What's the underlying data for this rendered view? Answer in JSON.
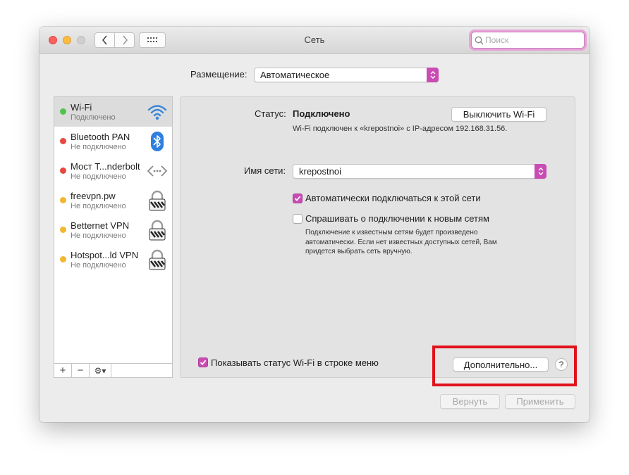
{
  "window": {
    "title": "Сеть"
  },
  "search": {
    "placeholder": "Поиск"
  },
  "location": {
    "label": "Размещение:",
    "value": "Автоматическое"
  },
  "services": [
    {
      "name": "Wi-Fi",
      "status": "Подключено",
      "status_color": "#4fc34a",
      "icon": "wifi-icon",
      "selected": true
    },
    {
      "name": "Bluetooth PAN",
      "status": "Не подключено",
      "status_color": "#e9473f",
      "icon": "bluetooth-icon"
    },
    {
      "name": "Мост T...nderbolt",
      "status": "Не подключено",
      "status_color": "#e9473f",
      "icon": "thunderbolt-bridge-icon"
    },
    {
      "name": "freevpn.pw",
      "status": "Не подключено",
      "status_color": "#f2b72f",
      "icon": "vpn-lock-icon"
    },
    {
      "name": "Betternet VPN",
      "status": "Не подключено",
      "status_color": "#f2b72f",
      "icon": "vpn-lock-icon"
    },
    {
      "name": "Hotspot...ld VPN",
      "status": "Не подключено",
      "status_color": "#f2b72f",
      "icon": "vpn-lock-icon"
    }
  ],
  "sidebar_tools": {
    "add": "+",
    "remove": "−",
    "gear": "⚙▾"
  },
  "panel": {
    "status_label": "Статус:",
    "status_value": "Подключено",
    "turn_off_button": "Выключить Wi-Fi",
    "status_detail": "Wi-Fi подключен к «krepostnoi» с IP-адресом 192.168.31.56.",
    "network_label": "Имя сети:",
    "network_value": "krepostnoi",
    "auto_join_label": "Автоматически подключаться к этой сети",
    "auto_join_checked": true,
    "ask_join_label": "Спрашивать о подключении к новым сетям",
    "ask_join_checked": false,
    "ask_join_note_1": "Подключение к известным сетям будет произведено",
    "ask_join_note_2": "автоматически. Если нет известных доступных сетей, Вам",
    "ask_join_note_3": "придется выбрать сеть вручную.",
    "show_status_label": "Показывать статус Wi-Fi в строке меню",
    "show_status_checked": true,
    "advanced_button": "Дополнительно...",
    "help_button": "?"
  },
  "footer": {
    "revert_button": "Вернуть",
    "apply_button": "Применить"
  },
  "colors": {
    "accent": "#c84cb3",
    "highlight_box": "#e0121c"
  }
}
